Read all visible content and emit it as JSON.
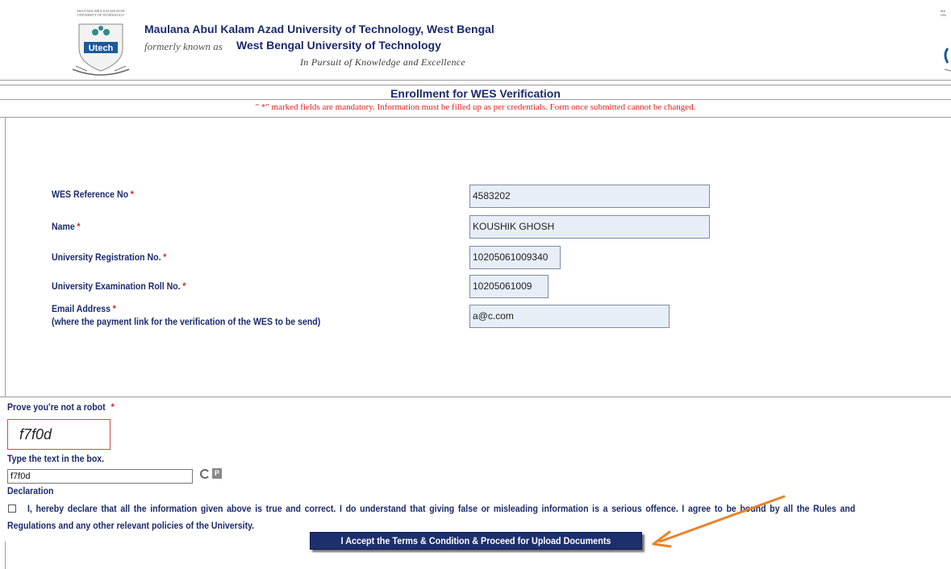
{
  "header": {
    "university_name": "Maulana Abul Kalam Azad University of Technology, West Bengal",
    "formerly_prefix": "formerly known as",
    "former_name": "West Bengal University of Technology",
    "motto": "In Pursuit of Knowledge and Excellence",
    "logo_text": "Utech"
  },
  "form": {
    "title": "Enrollment for WES Verification",
    "mandatory_note": "\" *\"  marked fields are mandatory. Information must be filled up as per credentials. Form once submitted cannot be changed.",
    "required_mark": "*",
    "fields": [
      {
        "label": "WES Reference No",
        "value": "4583202"
      },
      {
        "label": "Name",
        "value": "KOUSHIK GHOSH"
      },
      {
        "label": "University Registration No.",
        "value": "10205061009340"
      },
      {
        "label": "University Examination Roll No.",
        "value": "10205061009"
      },
      {
        "label": "Email Address",
        "sublabel": "(where the payment link for the verification of the WES to be send)",
        "value": "a@c.com"
      }
    ]
  },
  "captcha": {
    "label": "Prove you're not a robot",
    "image_text": "f7f0d",
    "instruction": "Type the text in the box.",
    "input_value": "f7f0d",
    "refresh_glyph": "C",
    "audio_glyph": "P"
  },
  "declaration": {
    "title": "Declaration",
    "text_line1": "I, hereby declare that all the information given above is true and correct. I do understand that giving false or misleading information is a serious offence. I agree to be bound by all the Rules and",
    "text_line2": "Regulations and any other relevant policies of the University.",
    "checked": false
  },
  "actions": {
    "accept_label": "I Accept the Terms & Condition & Proceed for Upload Documents"
  },
  "colors": {
    "label_blue": "#1b2a6b",
    "required_red": "#e02020",
    "button_navy": "#1e2f6e",
    "arrow_orange": "#e8832a",
    "field_bg": "#e8eef8"
  }
}
